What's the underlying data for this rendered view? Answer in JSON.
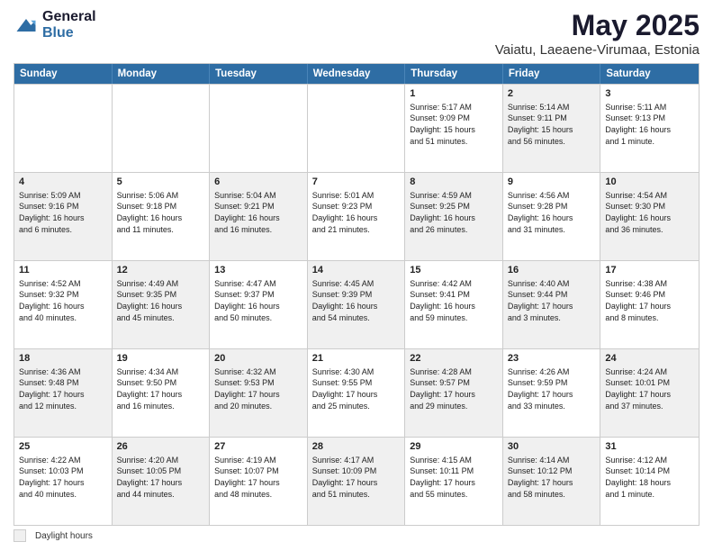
{
  "header": {
    "logo_general": "General",
    "logo_blue": "Blue",
    "title": "May 2025",
    "subtitle": "Vaiatu, Laeaene-Virumaa, Estonia"
  },
  "calendar": {
    "days": [
      "Sunday",
      "Monday",
      "Tuesday",
      "Wednesday",
      "Thursday",
      "Friday",
      "Saturday"
    ],
    "rows": [
      [
        {
          "day": "",
          "text": "",
          "empty": true
        },
        {
          "day": "",
          "text": "",
          "empty": true
        },
        {
          "day": "",
          "text": "",
          "empty": true
        },
        {
          "day": "",
          "text": "",
          "empty": true
        },
        {
          "day": "1",
          "text": "Sunrise: 5:17 AM\nSunset: 9:09 PM\nDaylight: 15 hours\nand 51 minutes.",
          "shaded": false
        },
        {
          "day": "2",
          "text": "Sunrise: 5:14 AM\nSunset: 9:11 PM\nDaylight: 15 hours\nand 56 minutes.",
          "shaded": true
        },
        {
          "day": "3",
          "text": "Sunrise: 5:11 AM\nSunset: 9:13 PM\nDaylight: 16 hours\nand 1 minute.",
          "shaded": false
        }
      ],
      [
        {
          "day": "4",
          "text": "Sunrise: 5:09 AM\nSunset: 9:16 PM\nDaylight: 16 hours\nand 6 minutes.",
          "shaded": true
        },
        {
          "day": "5",
          "text": "Sunrise: 5:06 AM\nSunset: 9:18 PM\nDaylight: 16 hours\nand 11 minutes.",
          "shaded": false
        },
        {
          "day": "6",
          "text": "Sunrise: 5:04 AM\nSunset: 9:21 PM\nDaylight: 16 hours\nand 16 minutes.",
          "shaded": true
        },
        {
          "day": "7",
          "text": "Sunrise: 5:01 AM\nSunset: 9:23 PM\nDaylight: 16 hours\nand 21 minutes.",
          "shaded": false
        },
        {
          "day": "8",
          "text": "Sunrise: 4:59 AM\nSunset: 9:25 PM\nDaylight: 16 hours\nand 26 minutes.",
          "shaded": true
        },
        {
          "day": "9",
          "text": "Sunrise: 4:56 AM\nSunset: 9:28 PM\nDaylight: 16 hours\nand 31 minutes.",
          "shaded": false
        },
        {
          "day": "10",
          "text": "Sunrise: 4:54 AM\nSunset: 9:30 PM\nDaylight: 16 hours\nand 36 minutes.",
          "shaded": true
        }
      ],
      [
        {
          "day": "11",
          "text": "Sunrise: 4:52 AM\nSunset: 9:32 PM\nDaylight: 16 hours\nand 40 minutes.",
          "shaded": false
        },
        {
          "day": "12",
          "text": "Sunrise: 4:49 AM\nSunset: 9:35 PM\nDaylight: 16 hours\nand 45 minutes.",
          "shaded": true
        },
        {
          "day": "13",
          "text": "Sunrise: 4:47 AM\nSunset: 9:37 PM\nDaylight: 16 hours\nand 50 minutes.",
          "shaded": false
        },
        {
          "day": "14",
          "text": "Sunrise: 4:45 AM\nSunset: 9:39 PM\nDaylight: 16 hours\nand 54 minutes.",
          "shaded": true
        },
        {
          "day": "15",
          "text": "Sunrise: 4:42 AM\nSunset: 9:41 PM\nDaylight: 16 hours\nand 59 minutes.",
          "shaded": false
        },
        {
          "day": "16",
          "text": "Sunrise: 4:40 AM\nSunset: 9:44 PM\nDaylight: 17 hours\nand 3 minutes.",
          "shaded": true
        },
        {
          "day": "17",
          "text": "Sunrise: 4:38 AM\nSunset: 9:46 PM\nDaylight: 17 hours\nand 8 minutes.",
          "shaded": false
        }
      ],
      [
        {
          "day": "18",
          "text": "Sunrise: 4:36 AM\nSunset: 9:48 PM\nDaylight: 17 hours\nand 12 minutes.",
          "shaded": true
        },
        {
          "day": "19",
          "text": "Sunrise: 4:34 AM\nSunset: 9:50 PM\nDaylight: 17 hours\nand 16 minutes.",
          "shaded": false
        },
        {
          "day": "20",
          "text": "Sunrise: 4:32 AM\nSunset: 9:53 PM\nDaylight: 17 hours\nand 20 minutes.",
          "shaded": true
        },
        {
          "day": "21",
          "text": "Sunrise: 4:30 AM\nSunset: 9:55 PM\nDaylight: 17 hours\nand 25 minutes.",
          "shaded": false
        },
        {
          "day": "22",
          "text": "Sunrise: 4:28 AM\nSunset: 9:57 PM\nDaylight: 17 hours\nand 29 minutes.",
          "shaded": true
        },
        {
          "day": "23",
          "text": "Sunrise: 4:26 AM\nSunset: 9:59 PM\nDaylight: 17 hours\nand 33 minutes.",
          "shaded": false
        },
        {
          "day": "24",
          "text": "Sunrise: 4:24 AM\nSunset: 10:01 PM\nDaylight: 17 hours\nand 37 minutes.",
          "shaded": true
        }
      ],
      [
        {
          "day": "25",
          "text": "Sunrise: 4:22 AM\nSunset: 10:03 PM\nDaylight: 17 hours\nand 40 minutes.",
          "shaded": false
        },
        {
          "day": "26",
          "text": "Sunrise: 4:20 AM\nSunset: 10:05 PM\nDaylight: 17 hours\nand 44 minutes.",
          "shaded": true
        },
        {
          "day": "27",
          "text": "Sunrise: 4:19 AM\nSunset: 10:07 PM\nDaylight: 17 hours\nand 48 minutes.",
          "shaded": false
        },
        {
          "day": "28",
          "text": "Sunrise: 4:17 AM\nSunset: 10:09 PM\nDaylight: 17 hours\nand 51 minutes.",
          "shaded": true
        },
        {
          "day": "29",
          "text": "Sunrise: 4:15 AM\nSunset: 10:11 PM\nDaylight: 17 hours\nand 55 minutes.",
          "shaded": false
        },
        {
          "day": "30",
          "text": "Sunrise: 4:14 AM\nSunset: 10:12 PM\nDaylight: 17 hours\nand 58 minutes.",
          "shaded": true
        },
        {
          "day": "31",
          "text": "Sunrise: 4:12 AM\nSunset: 10:14 PM\nDaylight: 18 hours\nand 1 minute.",
          "shaded": false
        }
      ]
    ]
  },
  "footer": {
    "shaded_label": "Daylight hours"
  }
}
